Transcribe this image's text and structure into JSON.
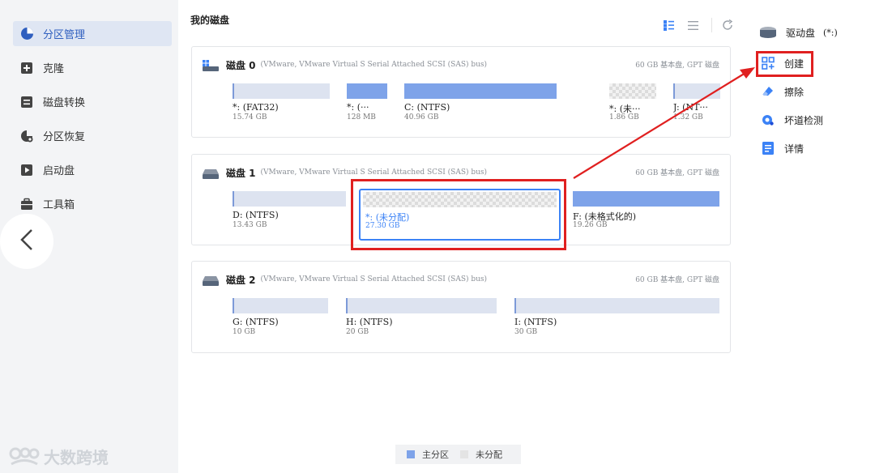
{
  "sidebar": {
    "items": [
      {
        "label": "分区管理",
        "icon": "pie-chart-icon"
      },
      {
        "label": "克隆",
        "icon": "clone-icon"
      },
      {
        "label": "磁盘转换",
        "icon": "convert-icon"
      },
      {
        "label": "分区恢复",
        "icon": "recovery-icon"
      },
      {
        "label": "启动盘",
        "icon": "boot-disk-icon"
      },
      {
        "label": "工具箱",
        "icon": "toolbox-icon"
      }
    ],
    "watermark": "大数跨境"
  },
  "main": {
    "title": "我的磁盘",
    "disks": [
      {
        "name": "磁盘 0",
        "desc": "(VMware,  VMware Virtual S Serial Attached SCSI (SAS) bus)",
        "size": "60 GB 基本盘, GPT 磁盘",
        "partitions": [
          {
            "label": "*: (FAT32)",
            "size": "15.74 GB",
            "type": "primary",
            "fill": 0.02
          },
          {
            "label": "*: (···",
            "size": "128 MB",
            "type": "primary",
            "fill": 1.0
          },
          {
            "label": "C: (NTFS)",
            "size": "40.96 GB",
            "type": "primary",
            "fill": 1.0
          },
          {
            "label": "*: (未···",
            "size": "1.86 GB",
            "type": "unallocated"
          },
          {
            "label": "J: (NT···",
            "size": "1.32 GB",
            "type": "primary",
            "fill": 0.02
          }
        ]
      },
      {
        "name": "磁盘 1",
        "desc": "(VMware,  VMware Virtual S Serial Attached SCSI (SAS) bus)",
        "size": "60 GB 基本盘, GPT 磁盘",
        "partitions": [
          {
            "label": "D: (NTFS)",
            "size": "13.43 GB",
            "type": "primary",
            "fill": 0.02
          },
          {
            "label": "*: (未分配)",
            "size": "27.30 GB",
            "type": "unallocated",
            "selected": true
          },
          {
            "label": "F: (未格式化的)",
            "size": "19.26 GB",
            "type": "primary",
            "fill": 1.0
          }
        ]
      },
      {
        "name": "磁盘 2",
        "desc": "(VMware,  VMware Virtual S Serial Attached SCSI (SAS) bus)",
        "size": "60 GB 基本盘, GPT 磁盘",
        "partitions": [
          {
            "label": "G: (NTFS)",
            "size": "10 GB",
            "type": "primary",
            "fill": 0.02
          },
          {
            "label": "H: (NTFS)",
            "size": "20 GB",
            "type": "primary",
            "fill": 0.02
          },
          {
            "label": "I: (NTFS)",
            "size": "30 GB",
            "type": "primary",
            "fill": 0.02
          }
        ]
      }
    ],
    "legend": {
      "primary": "主分区",
      "unallocated": "未分配"
    }
  },
  "rpanel": {
    "drive_label": "驱动盘",
    "drive_value": "(*:)",
    "actions": [
      {
        "label": "创建",
        "icon": "create-partition-icon"
      },
      {
        "label": "擦除",
        "icon": "eraser-icon"
      },
      {
        "label": "坏道检测",
        "icon": "surface-test-icon"
      },
      {
        "label": "详情",
        "icon": "details-icon"
      }
    ]
  },
  "colors": {
    "accent": "#3b82f6",
    "primary_partition": "#7ea3e9",
    "highlight": "#e02020",
    "active_nav_bg": "#dfe6f3"
  }
}
